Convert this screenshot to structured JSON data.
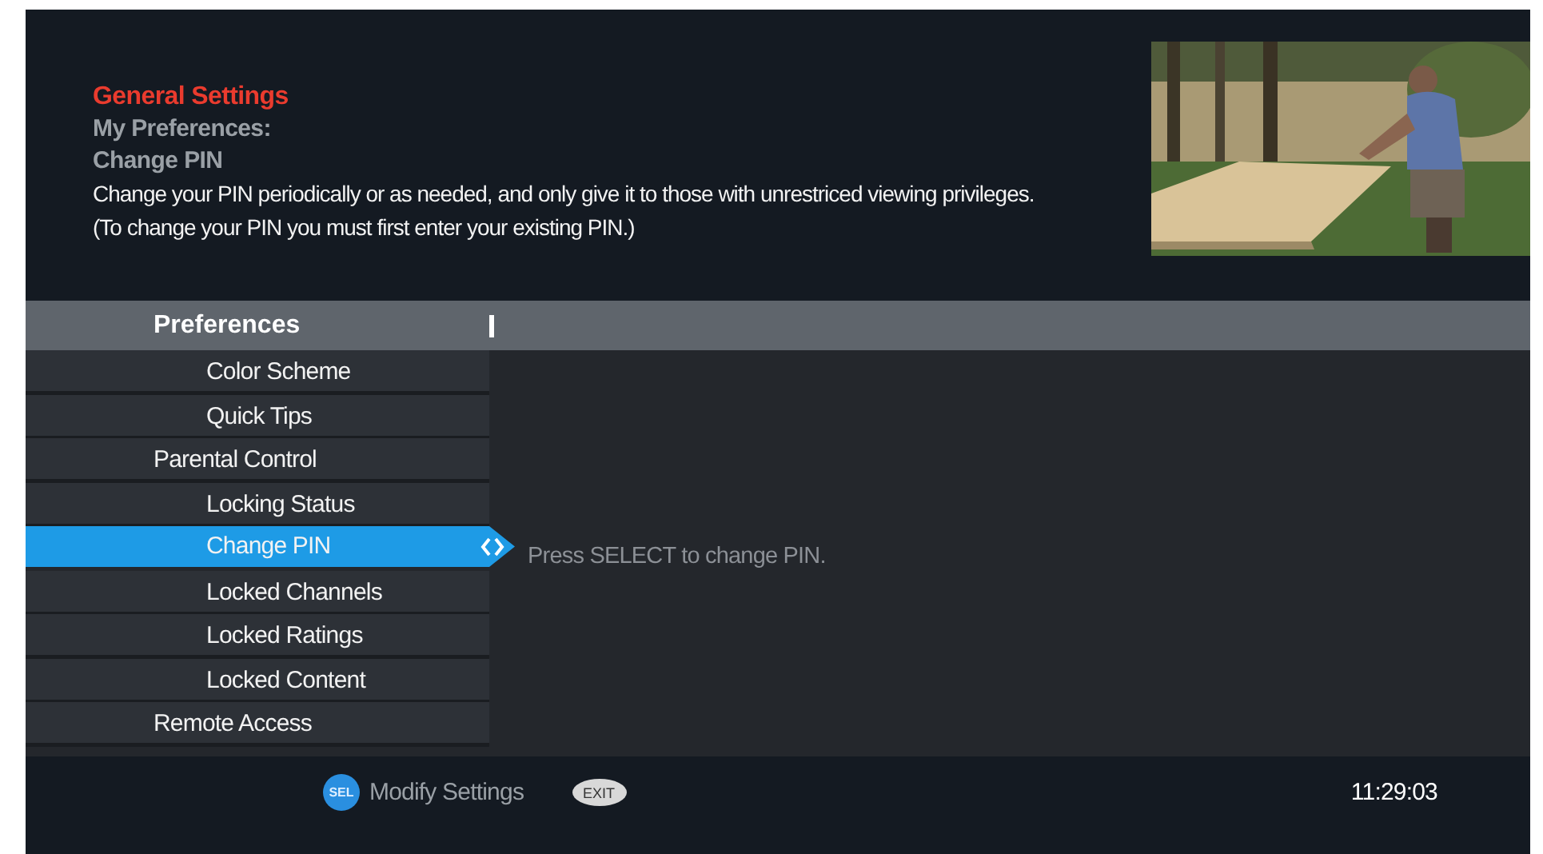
{
  "header": {
    "title": "General Settings",
    "section": "My Preferences:",
    "subsection": "Change PIN",
    "description": "Change your PIN periodically or as needed, and only give it to those with unrestriced viewing privileges. (To change your PIN you must first enter your existing PIN.)"
  },
  "menu": {
    "title": "Preferences",
    "items": [
      {
        "children": [
          {
            "label": "Color Scheme",
            "selected": false
          },
          {
            "label": "Quick Tips",
            "selected": false
          }
        ]
      },
      {
        "label": "Parental Control",
        "selected": false,
        "children": [
          {
            "label": "Locking Status",
            "selected": false
          },
          {
            "label": "Change PIN",
            "selected": true
          },
          {
            "label": "Locked Channels",
            "selected": false
          },
          {
            "label": "Locked Ratings",
            "selected": false
          },
          {
            "label": "Locked Content",
            "selected": false
          }
        ]
      },
      {
        "label": "Remote Access",
        "selected": false
      }
    ]
  },
  "detail": {
    "hint": "Press SELECT to change PIN."
  },
  "footer": {
    "select_key": "SEL",
    "select_action": "Modify Settings",
    "exit_key": "EXIT",
    "clock": "11:29:03"
  }
}
